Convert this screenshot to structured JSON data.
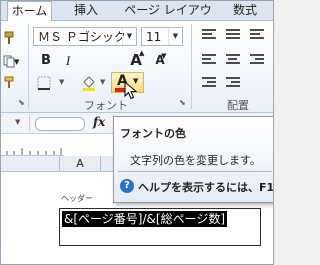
{
  "tabs": [
    {
      "label": "ホーム"
    },
    {
      "label": "挿入"
    },
    {
      "label": "ページ レイアウト"
    },
    {
      "label": "数式"
    }
  ],
  "font": {
    "name": "ＭＳ Ｐゴシック",
    "size": "11",
    "grow_label": "A",
    "shrink_label": "A",
    "bold": "B",
    "italic": "I",
    "underline": "U",
    "font_color_label": "A",
    "group_label": "フォント"
  },
  "alignment": {
    "group_label": "配置"
  },
  "colors": {
    "font_color": "#e0211b",
    "accent": "#2a6fcb"
  },
  "tooltip": {
    "title": "フォントの色",
    "description": "文字列の色を変更します。",
    "help": "ヘルプを表示するには、F1"
  },
  "formula_bar": {
    "fx": "fx"
  },
  "sheet": {
    "column_a": "A",
    "header_label": "ヘッダー",
    "header_content": "&[ページ番号]/&[総ページ数]"
  }
}
